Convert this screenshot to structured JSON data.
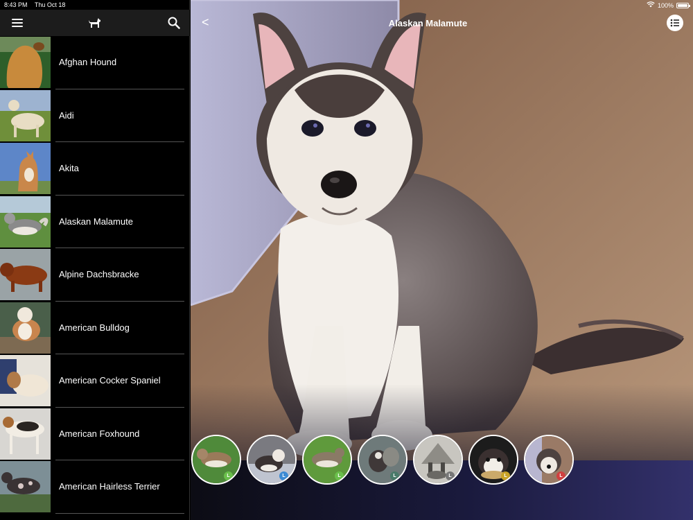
{
  "status_bar": {
    "time": "8:43 PM",
    "date": "Thu Oct 18",
    "battery": "100%"
  },
  "toolbar": {
    "menu_icon": "hamburger-menu-icon",
    "center_icon": "dog-icon",
    "search_icon": "search-icon"
  },
  "breeds": [
    {
      "name": "Afghan Hound"
    },
    {
      "name": "Aidi"
    },
    {
      "name": "Akita"
    },
    {
      "name": "Alaskan Malamute"
    },
    {
      "name": "Alpine Dachsbracke"
    },
    {
      "name": "American Bulldog"
    },
    {
      "name": "American Cocker Spaniel"
    },
    {
      "name": "American Foxhound"
    },
    {
      "name": "American Hairless Terrier"
    }
  ],
  "detail": {
    "back_label": "<",
    "title": "Alaskan Malamute",
    "list_icon": "list-icon",
    "gallery": [
      {
        "badge": "L",
        "badge_color": "#6abf4b"
      },
      {
        "badge": "L",
        "badge_color": "#3d8bd4"
      },
      {
        "badge": "L",
        "badge_color": "#6abf4b"
      },
      {
        "badge": "L",
        "badge_color": "#4a7a6a"
      },
      {
        "badge": "L",
        "badge_color": "#777777"
      },
      {
        "badge": "L",
        "badge_color": "#c9a227"
      },
      {
        "badge": "L",
        "badge_color": "#d04040"
      }
    ]
  }
}
